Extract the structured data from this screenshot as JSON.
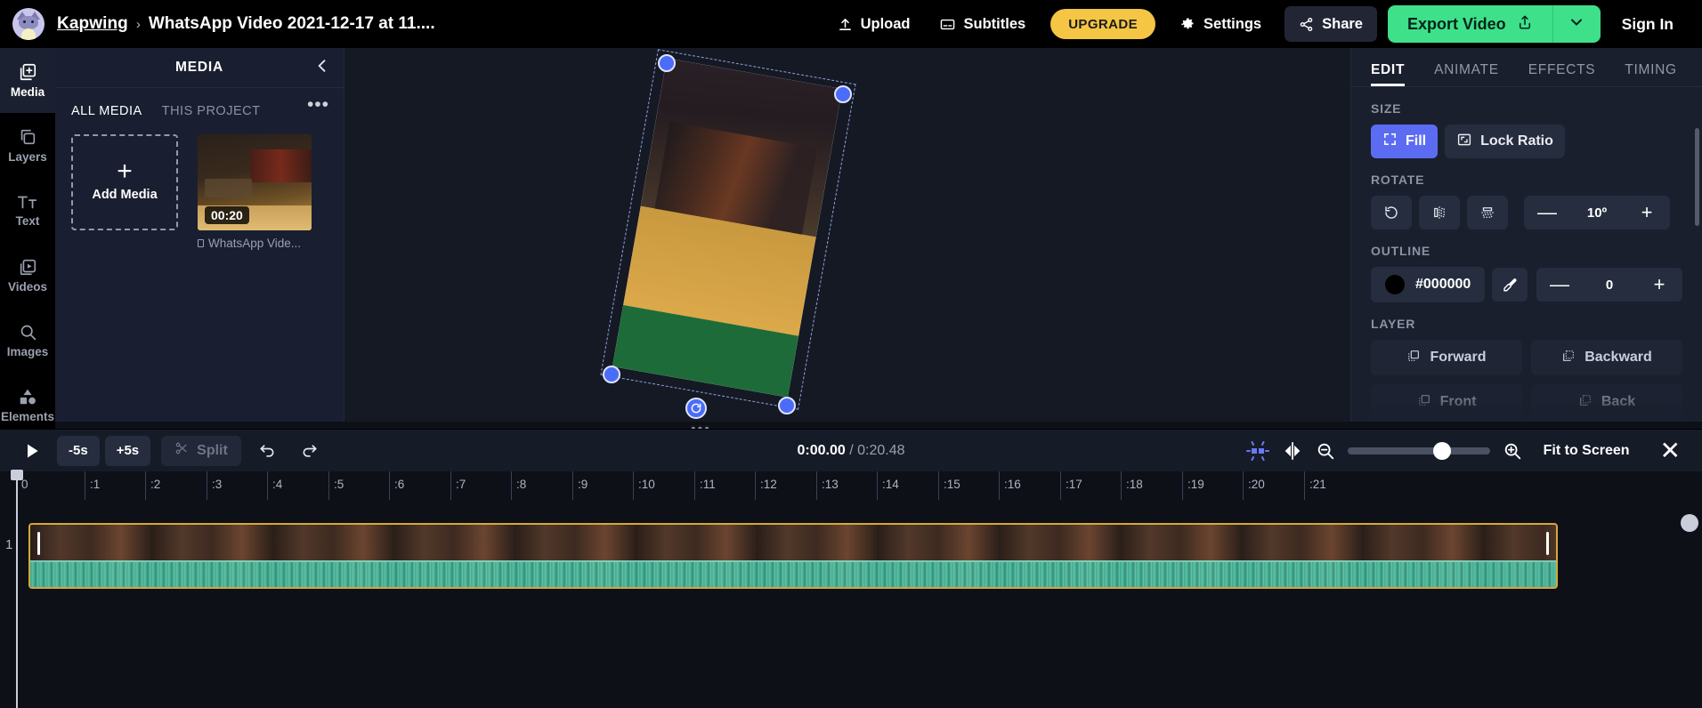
{
  "topbar": {
    "brand": "Kapwing",
    "separator": "›",
    "project_title": "WhatsApp Video 2021-12-17 at 11....",
    "upload_label": "Upload",
    "subtitles_label": "Subtitles",
    "upgrade_label": "UPGRADE",
    "settings_label": "Settings",
    "share_label": "Share",
    "export_label": "Export Video",
    "signin_label": "Sign In",
    "accent_green": "#3ee08a",
    "accent_yellow": "#f5c544"
  },
  "rail": {
    "items": [
      {
        "label": "Media",
        "icon": "media-icon",
        "active": true
      },
      {
        "label": "Layers",
        "icon": "layers-icon",
        "active": false
      },
      {
        "label": "Text",
        "icon": "text-icon",
        "active": false
      },
      {
        "label": "Videos",
        "icon": "videos-icon",
        "active": false
      },
      {
        "label": "Images",
        "icon": "images-icon",
        "active": false
      },
      {
        "label": "Elements",
        "icon": "elements-icon",
        "active": false
      }
    ]
  },
  "media_panel": {
    "title": "MEDIA",
    "tabs": [
      {
        "label": "ALL MEDIA",
        "active": true
      },
      {
        "label": "THIS PROJECT",
        "active": false
      }
    ],
    "overflow": "•••",
    "add_media_label": "Add Media",
    "add_media_plus": "+",
    "items": [
      {
        "duration": "00:20",
        "name": "WhatsApp Vide..."
      }
    ]
  },
  "right_panel": {
    "tabs": [
      {
        "label": "EDIT",
        "active": true
      },
      {
        "label": "ANIMATE",
        "active": false
      },
      {
        "label": "EFFECTS",
        "active": false
      },
      {
        "label": "TIMING",
        "active": false
      }
    ],
    "size": {
      "label": "SIZE",
      "fill_label": "Fill",
      "lock_ratio_label": "Lock Ratio"
    },
    "rotate": {
      "label": "ROTATE",
      "value": "10º",
      "minus": "—",
      "plus": "+",
      "icons": [
        "rotate-cw-icon",
        "flip-horizontal-icon",
        "flip-vertical-icon"
      ]
    },
    "outline": {
      "label": "OUTLINE",
      "color": "#000000",
      "width_value": "0",
      "minus": "—",
      "plus": "+",
      "eyedropper": "eyedropper-icon"
    },
    "layer": {
      "label": "LAYER",
      "forward_label": "Forward",
      "backward_label": "Backward",
      "front_label": "Front",
      "back_label": "Back"
    }
  },
  "timeline": {
    "play_icon": "play-icon",
    "back_label": "-5s",
    "forward_label": "+5s",
    "split_label": "Split",
    "undo_icon": "undo-icon",
    "redo_icon": "redo-icon",
    "current_time": "0:00.00",
    "time_divider": " / ",
    "total_time": "0:20.48",
    "fit_label": "Fit to Screen",
    "close_label": "✕",
    "track_number": "1",
    "ruler_ticks": [
      "0",
      ":1",
      ":2",
      ":3",
      ":4",
      ":5",
      ":6",
      ":7",
      ":8",
      ":9",
      ":10",
      ":11",
      ":12",
      ":13",
      ":14",
      ":15",
      ":16",
      ":17",
      ":18",
      ":19",
      ":20",
      ":21"
    ]
  },
  "canvas": {
    "handles_icon": "resize-handle",
    "rotate_handle_icon": "rotate-handle-icon",
    "drag_dots": "•••"
  }
}
